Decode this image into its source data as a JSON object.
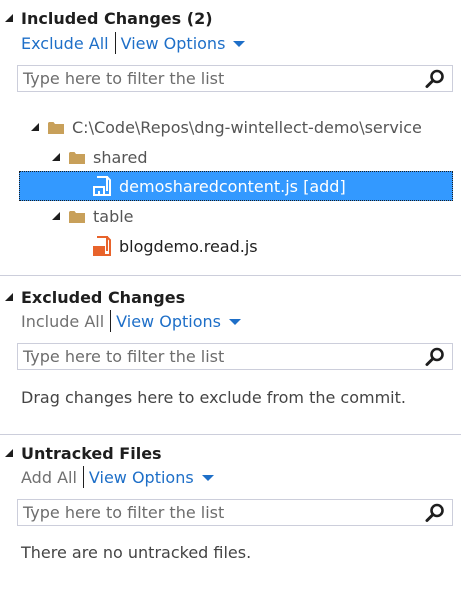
{
  "included": {
    "title": "Included Changes (2)",
    "exclude_all": "Exclude All",
    "view_options": "View Options",
    "filter_placeholder": "Type here to filter the list",
    "tree": {
      "root": "C:\\Code\\Repos\\dng-wintellect-demo\\service",
      "folders": [
        {
          "name": "shared",
          "files": [
            "demosharedcontent.js [add]"
          ]
        },
        {
          "name": "table",
          "files": [
            "blogdemo.read.js"
          ]
        }
      ]
    }
  },
  "excluded": {
    "title": "Excluded Changes",
    "include_all": "Include All",
    "view_options": "View Options",
    "filter_placeholder": "Type here to filter the list",
    "empty_message": "Drag changes here to exclude from the commit."
  },
  "untracked": {
    "title": "Untracked Files",
    "add_all": "Add All",
    "view_options": "View Options",
    "filter_placeholder": "Type here to filter the list",
    "empty_message": "There are no untracked files."
  },
  "colors": {
    "link": "#1e6fc8",
    "selection": "#3399ff",
    "folder": "#c8a05a",
    "js_file_icon": "#e8632b"
  },
  "icons": {
    "collapse": "expanded-triangle-icon",
    "search": "search-icon",
    "folder": "folder-icon",
    "file": "javascript-file-icon"
  }
}
